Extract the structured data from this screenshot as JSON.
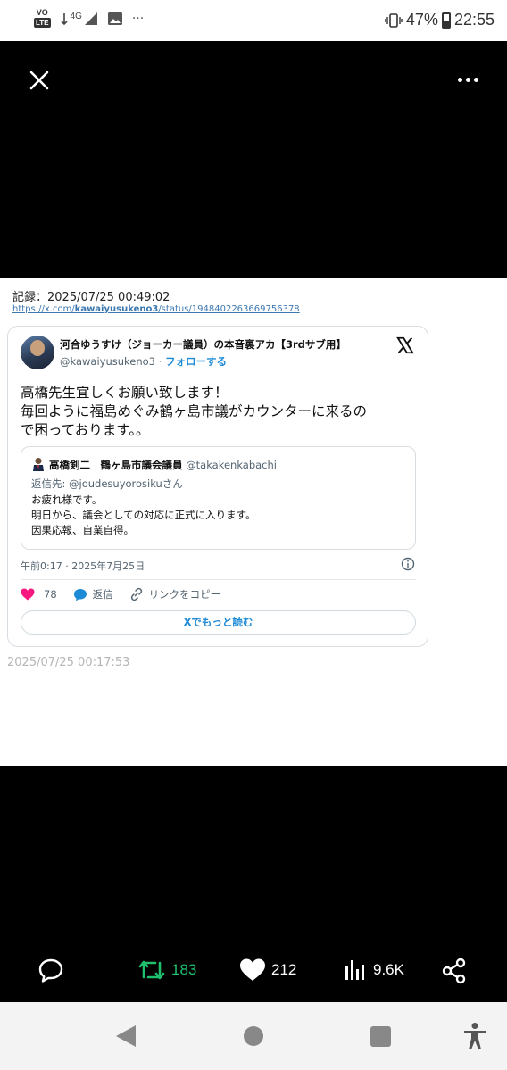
{
  "status_bar": {
    "volte_top": "VO",
    "volte_bottom": "LTE",
    "signal": "4G",
    "dots": "···",
    "battery_percent": "47%",
    "time": "22:55"
  },
  "viewer": {
    "icons": {
      "close": "close-icon",
      "more": "more-icon"
    }
  },
  "post_image": {
    "record_line": "記録：2025/07/25 00:49:02",
    "url_prefix": "https://x.com/",
    "url_handle": "kawaiyusukeno3",
    "url_suffix": "/status/1948402263669756378",
    "tweet": {
      "author_name": "河合ゆうすけ（ジョーカー議員）の本音裏アカ【3rdサブ用】",
      "author_handle": "@kawaiyusukeno3 · ",
      "follow_label": "フォローする",
      "body_lines": [
        "高橋先生宜しくお願い致します！",
        "毎回ように福島めぐみ鶴ヶ島市議がカウンターに来るの",
        "で困っております。。"
      ],
      "quote": {
        "name": "高橋剣二　鶴ヶ島市議会議員",
        "handle": " @takakenkabachi",
        "reply_to": "返信先: @joudesuyorosikuさん",
        "body_lines": [
          "お疲れ様です。",
          "明日から、議会としての対応に正式に入ります。",
          "因果応報、自業自得。"
        ]
      },
      "timestamp": "午前0:17 · 2025年7月25日",
      "likes": "78",
      "reply_label": "返信",
      "copy_link_label": "リンクをコピー",
      "read_more_label": "Xでもっと読む"
    },
    "capture_stamp": "2025/07/25 00:17:53"
  },
  "engagement": {
    "retweets": "183",
    "likes": "212",
    "views": "9.6K",
    "colors": {
      "retweet": "#1fbf6e",
      "icon": "#ffffff"
    }
  }
}
